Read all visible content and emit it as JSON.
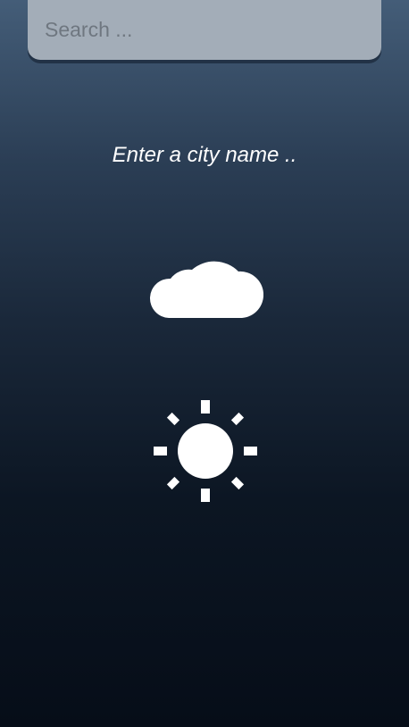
{
  "search": {
    "placeholder": "Search ..."
  },
  "message": {
    "prompt": "Enter a city name .."
  },
  "icons": {
    "cloud": "cloud-icon",
    "sun": "sun-icon"
  },
  "colors": {
    "background_top": "#445d78",
    "background_bottom": "#060d18",
    "search_bg": "#a3adb8",
    "icon": "#ffffff"
  }
}
